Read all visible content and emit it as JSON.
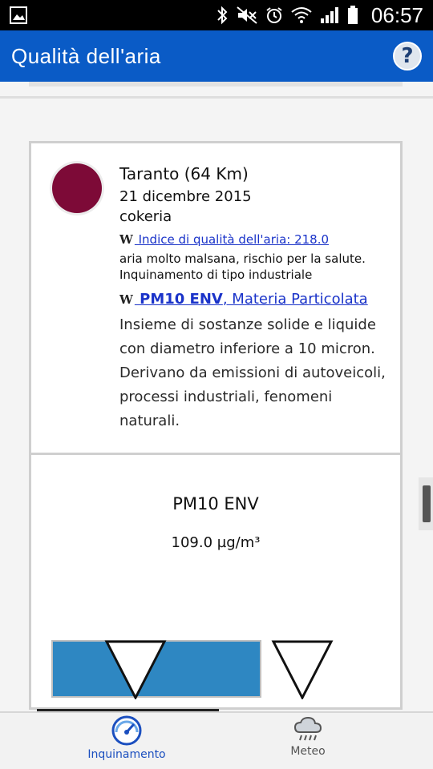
{
  "status_bar": {
    "time": "06:57",
    "icons": [
      "gallery-icon",
      "bluetooth-icon",
      "mute-icon",
      "alarm-icon",
      "wifi-icon",
      "signal-icon",
      "battery-icon"
    ]
  },
  "app_bar": {
    "title": "Qualità dell'aria",
    "help_icon": "help-icon",
    "help_label": "?",
    "color": "#0a5bc6"
  },
  "station": {
    "name": "Taranto (64 Km)",
    "date": "21 dicembre 2015",
    "type": "cokeria",
    "status_color": "#7d0a37"
  },
  "aqi": {
    "wiki_mark": "W",
    "link": " Indice di qualità dell'aria: 218.0",
    "description": "aria molto malsana, rischio per la salute. Inquinamento di tipo industriale"
  },
  "pollutant": {
    "wiki_mark": "W",
    "code": " PM10 ENV",
    "name": ", Materia Particolata",
    "description": "Insieme di sostanze solide e liquide con diametro inferiore a 10 micron. Derivano da emissioni di autoveicoli, processi industriali, fenomeni naturali."
  },
  "gauge": {
    "label": "PM10 ENV",
    "value": "109.0 µg/m³",
    "active_color": "#2e87c2"
  },
  "bottom_nav": {
    "items": [
      {
        "label": "Inquinamento",
        "icon": "gauge-icon",
        "active": true
      },
      {
        "label": "Meteo",
        "icon": "weather-icon",
        "active": false
      }
    ]
  }
}
